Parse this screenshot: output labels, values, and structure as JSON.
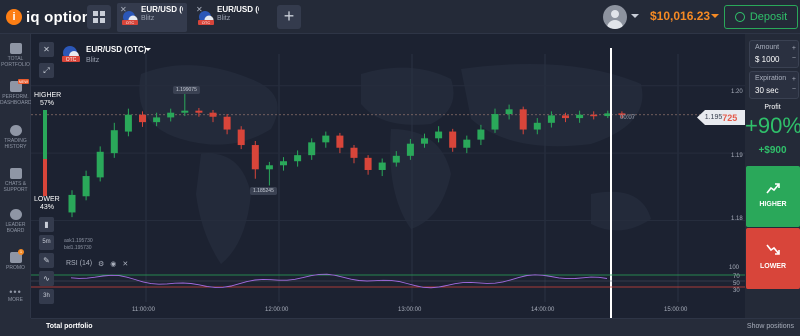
{
  "brand": {
    "name": "iq option",
    "mark": "i"
  },
  "tabs": [
    {
      "asset": "EUR/USD (O...",
      "mode": "Blitz",
      "active": true
    },
    {
      "asset": "EUR/USD (O...",
      "mode": "Blitz",
      "active": false
    }
  ],
  "header": {
    "balance": "$10,016.23",
    "deposit_label": "Deposit"
  },
  "sidebar": {
    "items": [
      {
        "label": "TOTAL PORTFOLIO",
        "icon": "briefcase-icon"
      },
      {
        "label": "PERFORM. DASHBOARD",
        "icon": "dashboard-icon",
        "badge": "NEW"
      },
      {
        "label": "TRADING HISTORY",
        "icon": "clock-icon"
      },
      {
        "label": "CHATS & SUPPORT",
        "icon": "chat-icon"
      },
      {
        "label": "LEADER BOARD",
        "icon": "leaderboard-icon"
      },
      {
        "label": "PROMO",
        "icon": "megaphone-icon",
        "badge": "1"
      },
      {
        "label": "MORE",
        "icon": "more-icon"
      }
    ]
  },
  "asset": {
    "name": "EUR/USD (OTC)",
    "mode": "Blitz"
  },
  "sentiment": {
    "higher_label": "HIGHER",
    "higher_pct": "57%",
    "lower_label": "LOWER",
    "lower_pct": "43%"
  },
  "chart_tools": {
    "timeframe": "5m",
    "candle_size": "3h"
  },
  "ask_bid": {
    "ask": "ask1.195730",
    "bid": "bid1.195730"
  },
  "indicator": {
    "name": "RSI (14)"
  },
  "price": {
    "current_prefix": "1.195",
    "current_suffix": "725",
    "timer": "00:07",
    "high_tooltip": "1.199075",
    "low_tooltip": "1.185245"
  },
  "chart_data": {
    "type": "candlestick",
    "y_axis_ticks": [
      "1.20",
      "1.19",
      "1.18"
    ],
    "rsi_ticks": [
      "100",
      "70",
      "50",
      "30"
    ],
    "x_axis_ticks": [
      "11:00:00",
      "12:00:00",
      "13:00:00",
      "14:00:00",
      "15:00:00"
    ],
    "candles": [
      {
        "o": 1.1812,
        "c": 1.1838,
        "h": 1.1845,
        "l": 1.1805
      },
      {
        "o": 1.1836,
        "c": 1.1866,
        "h": 1.1874,
        "l": 1.183
      },
      {
        "o": 1.1864,
        "c": 1.1902,
        "h": 1.191,
        "l": 1.1858
      },
      {
        "o": 1.19,
        "c": 1.1934,
        "h": 1.1945,
        "l": 1.1893
      },
      {
        "o": 1.1932,
        "c": 1.1957,
        "h": 1.1966,
        "l": 1.1925
      },
      {
        "o": 1.1957,
        "c": 1.1946,
        "h": 1.1962,
        "l": 1.1939
      },
      {
        "o": 1.1946,
        "c": 1.1953,
        "h": 1.196,
        "l": 1.194
      },
      {
        "o": 1.1953,
        "c": 1.196,
        "h": 1.1966,
        "l": 1.1947
      },
      {
        "o": 1.196,
        "c": 1.1963,
        "h": 1.199,
        "l": 1.1955
      },
      {
        "o": 1.1963,
        "c": 1.196,
        "h": 1.1967,
        "l": 1.1954
      },
      {
        "o": 1.196,
        "c": 1.1954,
        "h": 1.1964,
        "l": 1.1946
      },
      {
        "o": 1.1954,
        "c": 1.1935,
        "h": 1.1958,
        "l": 1.1928
      },
      {
        "o": 1.1935,
        "c": 1.1912,
        "h": 1.194,
        "l": 1.1906
      },
      {
        "o": 1.1912,
        "c": 1.1876,
        "h": 1.1918,
        "l": 1.1862
      },
      {
        "o": 1.1876,
        "c": 1.1882,
        "h": 1.1887,
        "l": 1.1852
      },
      {
        "o": 1.1882,
        "c": 1.1888,
        "h": 1.1894,
        "l": 1.1874
      },
      {
        "o": 1.1888,
        "c": 1.1897,
        "h": 1.1904,
        "l": 1.188
      },
      {
        "o": 1.1897,
        "c": 1.1916,
        "h": 1.1922,
        "l": 1.189
      },
      {
        "o": 1.1916,
        "c": 1.1926,
        "h": 1.1932,
        "l": 1.1908
      },
      {
        "o": 1.1926,
        "c": 1.1908,
        "h": 1.193,
        "l": 1.19
      },
      {
        "o": 1.1908,
        "c": 1.1893,
        "h": 1.1912,
        "l": 1.1885
      },
      {
        "o": 1.1893,
        "c": 1.1875,
        "h": 1.1897,
        "l": 1.1868
      },
      {
        "o": 1.1875,
        "c": 1.1886,
        "h": 1.1892,
        "l": 1.1866
      },
      {
        "o": 1.1886,
        "c": 1.1896,
        "h": 1.1903,
        "l": 1.188
      },
      {
        "o": 1.1896,
        "c": 1.1914,
        "h": 1.1921,
        "l": 1.189
      },
      {
        "o": 1.1914,
        "c": 1.1922,
        "h": 1.1929,
        "l": 1.1908
      },
      {
        "o": 1.1922,
        "c": 1.1932,
        "h": 1.194,
        "l": 1.1916
      },
      {
        "o": 1.1932,
        "c": 1.1908,
        "h": 1.1936,
        "l": 1.1902
      },
      {
        "o": 1.1908,
        "c": 1.192,
        "h": 1.1926,
        "l": 1.19
      },
      {
        "o": 1.192,
        "c": 1.1935,
        "h": 1.1942,
        "l": 1.1912
      },
      {
        "o": 1.1935,
        "c": 1.1958,
        "h": 1.1966,
        "l": 1.193
      },
      {
        "o": 1.1958,
        "c": 1.1965,
        "h": 1.1972,
        "l": 1.195
      },
      {
        "o": 1.1965,
        "c": 1.1935,
        "h": 1.1969,
        "l": 1.1928
      },
      {
        "o": 1.1935,
        "c": 1.1945,
        "h": 1.1952,
        "l": 1.1928
      },
      {
        "o": 1.1945,
        "c": 1.1956,
        "h": 1.1962,
        "l": 1.1938
      },
      {
        "o": 1.1956,
        "c": 1.1952,
        "h": 1.196,
        "l": 1.1946
      },
      {
        "o": 1.1952,
        "c": 1.1957,
        "h": 1.1963,
        "l": 1.1945
      },
      {
        "o": 1.1957,
        "c": 1.1955,
        "h": 1.1962,
        "l": 1.195
      },
      {
        "o": 1.1955,
        "c": 1.1959,
        "h": 1.1963,
        "l": 1.1952
      },
      {
        "o": 1.1959,
        "c": 1.1957,
        "h": 1.1962,
        "l": 1.1952
      }
    ]
  },
  "right_panel": {
    "amount_label": "Amount",
    "amount_value": "$ 1000",
    "expiration_label": "Expiration",
    "expiration_value": "30 sec",
    "profit_label": "Profit",
    "profit_pct": "+90%",
    "profit_amount": "+$900",
    "higher_label": "HIGHER",
    "lower_label": "LOWER"
  },
  "bottom": {
    "total_portfolio": "Total portfolio",
    "show_positions": "Show positions"
  },
  "colors": {
    "up": "#2aa85a",
    "down": "#d8453a",
    "accent": "#f58a24"
  }
}
